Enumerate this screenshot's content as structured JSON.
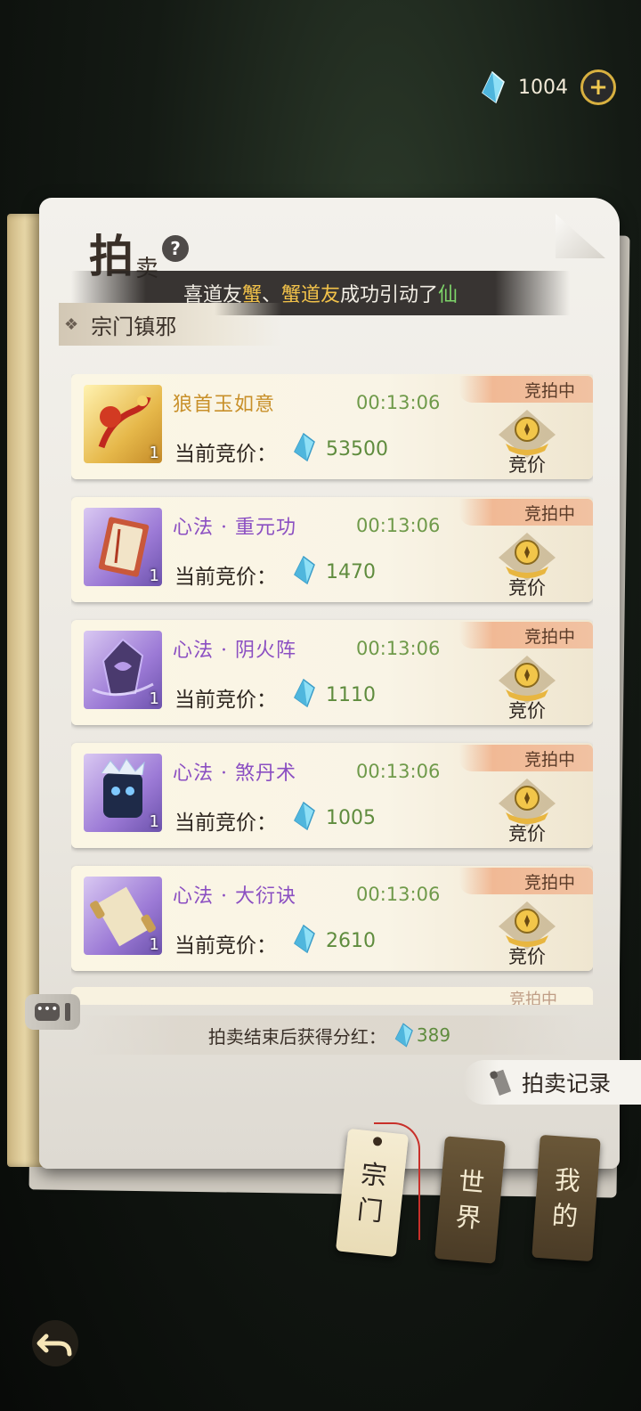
{
  "header": {
    "currency_amount": "1004",
    "plus_label": "+"
  },
  "title": {
    "main": "拍",
    "sub": "卖",
    "help": "?"
  },
  "marquee": {
    "part1": "喜道友",
    "name1": "蟹",
    "sep": "、",
    "name2": "蟹道友",
    "part2": "成功引动了",
    "tail": "仙"
  },
  "section": {
    "label": "宗门镇邪"
  },
  "auction": {
    "bid_label": "当前竞价：",
    "status_label": "竞拍中",
    "bid_button_label": "竞价",
    "items": [
      {
        "name": "狼首玉如意",
        "timer": "00:13:06",
        "bid": "53500",
        "qty": "1",
        "rarity": "gold"
      },
      {
        "name": "心法 · 重元功",
        "timer": "00:13:06",
        "bid": "1470",
        "qty": "1",
        "rarity": "purple"
      },
      {
        "name": "心法 · 阴火阵",
        "timer": "00:13:06",
        "bid": "1110",
        "qty": "1",
        "rarity": "purple"
      },
      {
        "name": "心法 · 煞丹术",
        "timer": "00:13:06",
        "bid": "1005",
        "qty": "1",
        "rarity": "purple"
      },
      {
        "name": "心法 · 大衍诀",
        "timer": "00:13:06",
        "bid": "2610",
        "qty": "1",
        "rarity": "purple"
      }
    ],
    "peek_status": "竞拍中"
  },
  "footer": {
    "dividend_label": "拍卖结束后获得分红：",
    "dividend_value": "389",
    "records_label": "拍卖记录"
  },
  "tabs": [
    {
      "line1": "宗",
      "line2": "门",
      "active": true
    },
    {
      "line1": "世",
      "line2": "界",
      "active": false
    },
    {
      "line1": "我",
      "line2": "的",
      "active": false
    }
  ],
  "chat": {
    "dots": "•••"
  },
  "colors": {
    "gem": "#7fd3ee",
    "gold_name": "#c8902a",
    "purple_name": "#8b4fc2",
    "timer_green": "#6f9a4a",
    "bid_green": "#5f8c3e",
    "status_tab": "#f1b995"
  },
  "icons": {
    "currency": "spirit-gem-icon",
    "help": "question-icon",
    "bid": "coin-hand-icon",
    "records": "scroll-icon",
    "back": "undo-arrow-icon"
  }
}
